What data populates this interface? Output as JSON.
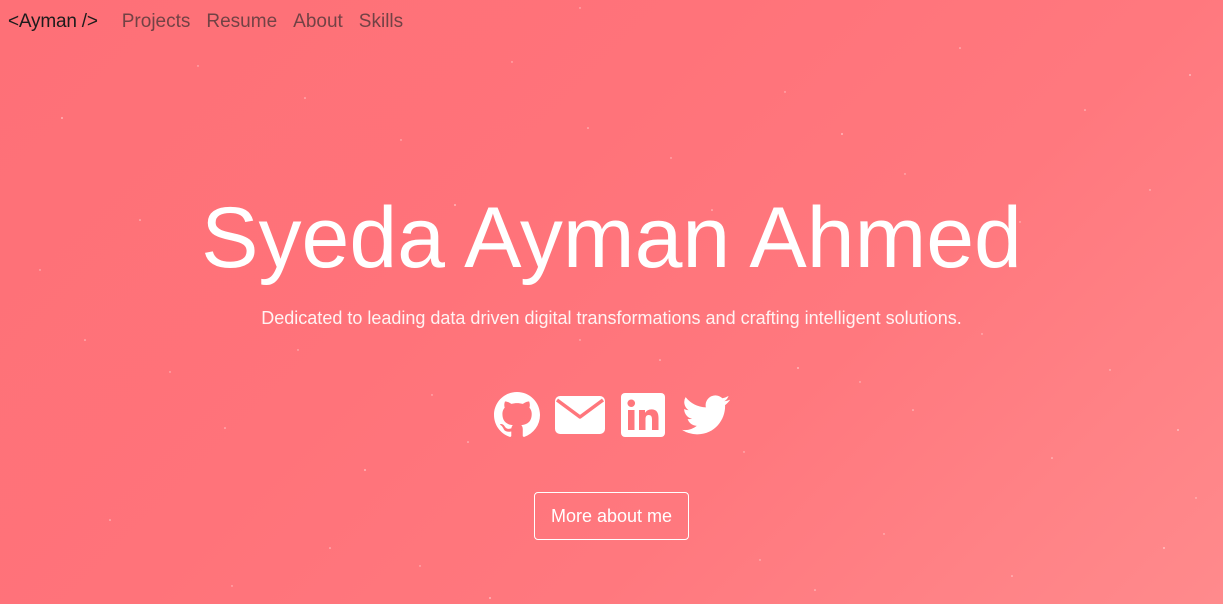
{
  "nav": {
    "brand": "<Ayman />",
    "links": [
      "Projects",
      "Resume",
      "About",
      "Skills"
    ]
  },
  "hero": {
    "title": "Syeda Ayman Ahmed",
    "subtitle": "Dedicated to leading data driven digital transformations and crafting intelligent solutions."
  },
  "social": [
    {
      "icon": "github-icon"
    },
    {
      "icon": "envelope-icon"
    },
    {
      "icon": "linkedin-icon"
    },
    {
      "icon": "twitter-icon"
    }
  ],
  "cta": {
    "label": "More about me"
  },
  "colors": {
    "background_start": "#fe7077",
    "background_end": "#ff8a8c",
    "text": "#ffffff",
    "brand_text": "#1c1c1c"
  }
}
